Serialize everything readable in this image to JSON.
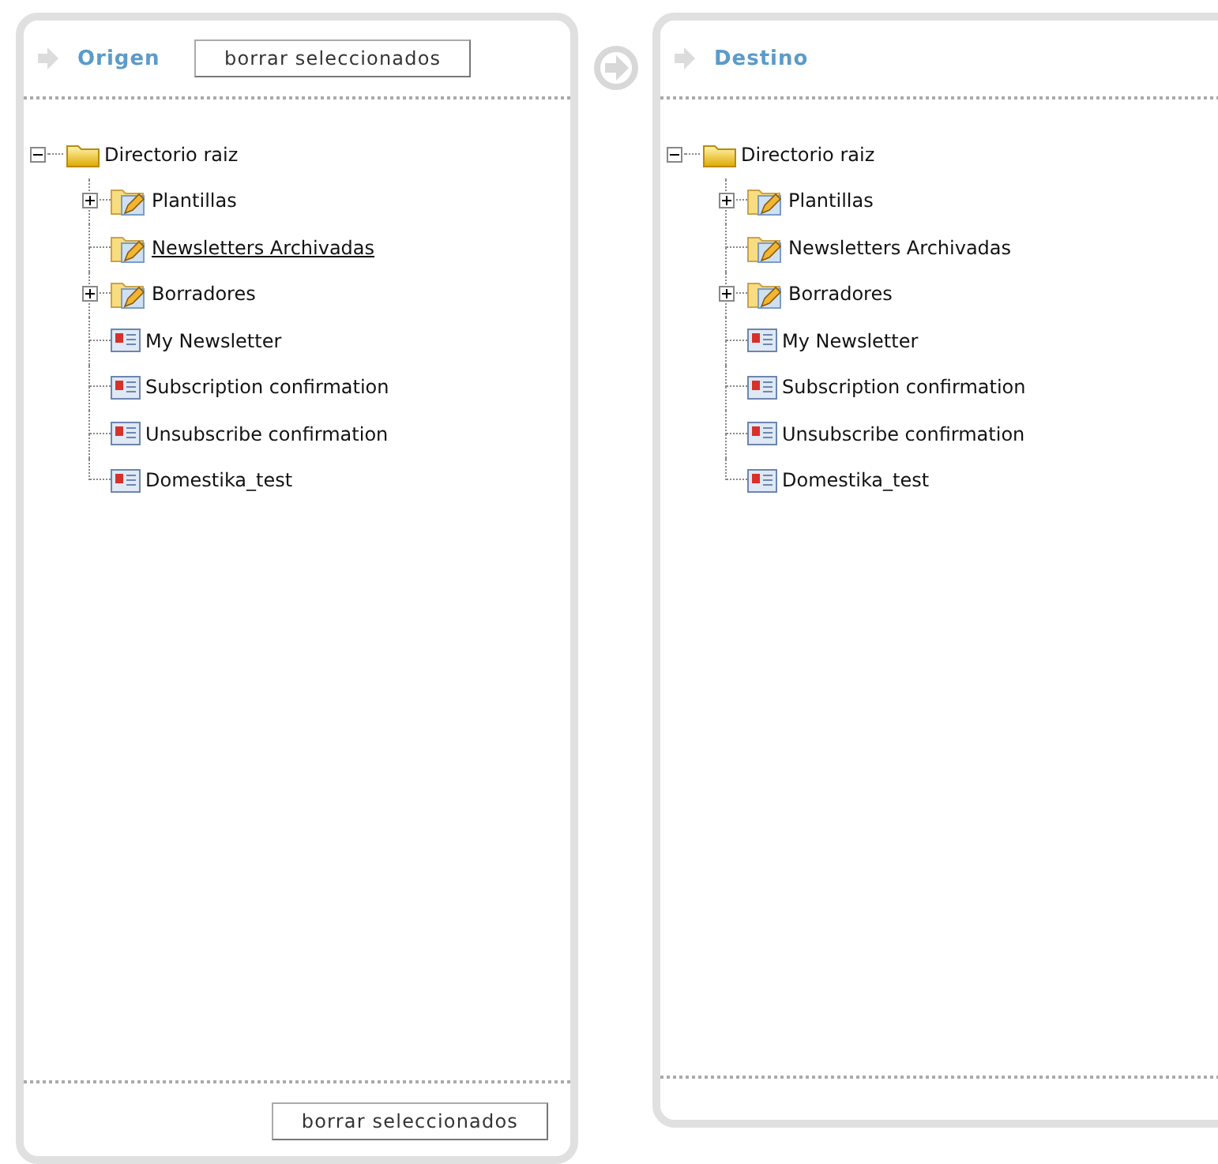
{
  "panels": [
    {
      "title": "Origen",
      "header_button": "borrar seleccionados",
      "footer_button": "borrar seleccionados",
      "tree": {
        "label": "Directorio raiz",
        "kind": "root",
        "expanded": true,
        "selected": false,
        "children": [
          {
            "label": "Plantillas",
            "kind": "folder",
            "expandable": true,
            "selected": false
          },
          {
            "label": "Newsletters Archivadas",
            "kind": "folder",
            "expandable": false,
            "selected": true
          },
          {
            "label": "Borradores",
            "kind": "folder",
            "expandable": true,
            "selected": false
          },
          {
            "label": "My Newsletter",
            "kind": "newsletter",
            "expandable": false,
            "selected": false
          },
          {
            "label": "Subscription confirmation",
            "kind": "newsletter",
            "expandable": false,
            "selected": false
          },
          {
            "label": "Unsubscribe confirmation",
            "kind": "newsletter",
            "expandable": false,
            "selected": false
          },
          {
            "label": "Domestika_test",
            "kind": "newsletter",
            "expandable": false,
            "selected": false
          }
        ]
      }
    },
    {
      "title": "Destino",
      "tree": {
        "label": "Directorio raiz",
        "kind": "root",
        "expanded": true,
        "selected": false,
        "children": [
          {
            "label": "Plantillas",
            "kind": "folder",
            "expandable": true,
            "selected": false
          },
          {
            "label": "Newsletters Archivadas",
            "kind": "folder",
            "expandable": false,
            "selected": false
          },
          {
            "label": "Borradores",
            "kind": "folder",
            "expandable": true,
            "selected": false
          },
          {
            "label": "My Newsletter",
            "kind": "newsletter",
            "expandable": false,
            "selected": false
          },
          {
            "label": "Subscription confirmation",
            "kind": "newsletter",
            "expandable": false,
            "selected": false
          },
          {
            "label": "Unsubscribe confirmation",
            "kind": "newsletter",
            "expandable": false,
            "selected": false
          },
          {
            "label": "Domestika_test",
            "kind": "newsletter",
            "expandable": false,
            "selected": false
          }
        ]
      }
    }
  ]
}
